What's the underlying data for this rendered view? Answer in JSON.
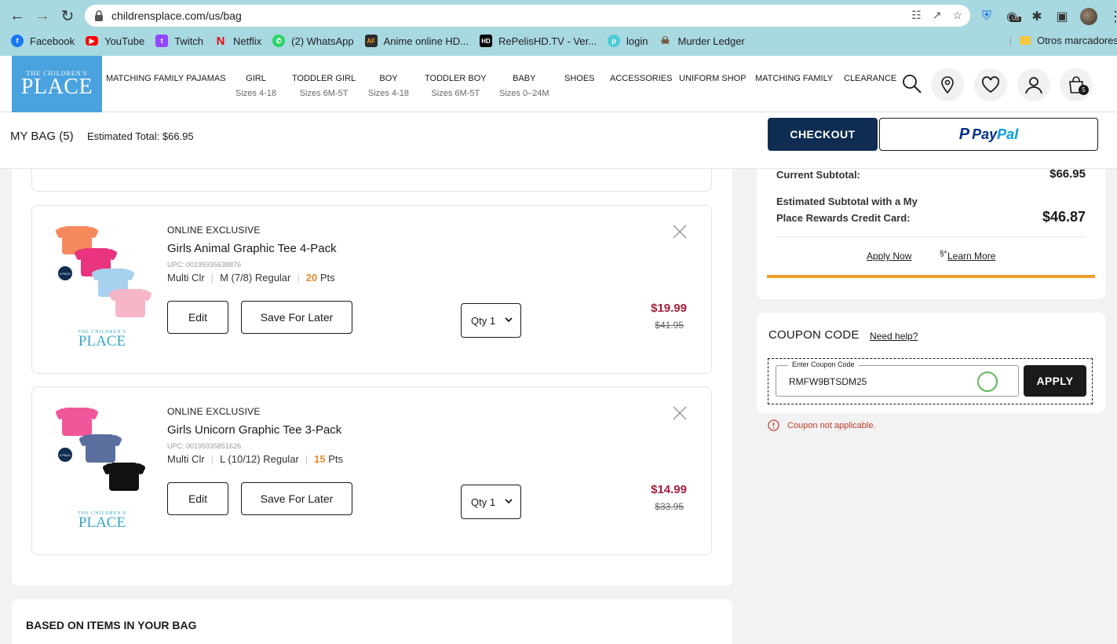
{
  "browser": {
    "url": "childrensplace.com/us/bag",
    "bookmarks": [
      {
        "label": "Facebook",
        "icon": "facebook-icon",
        "color": "#1877f2"
      },
      {
        "label": "YouTube",
        "icon": "youtube-icon",
        "color": "#ff0000"
      },
      {
        "label": "Twitch",
        "icon": "twitch-icon",
        "color": "#9146ff"
      },
      {
        "label": "Netflix",
        "icon": "netflix-icon",
        "color": "#e50914"
      },
      {
        "label": "(2) WhatsApp",
        "icon": "whatsapp-icon",
        "color": "#25d366"
      },
      {
        "label": "Anime online HD...",
        "icon": "animeflv-icon",
        "color": "#2d2d2d"
      },
      {
        "label": "RePelisHD.TV - Ver...",
        "icon": "hd-icon",
        "color": "#000000"
      },
      {
        "label": "login",
        "icon": "tplink-icon",
        "color": "#4acbd6"
      },
      {
        "label": "Murder Ledger",
        "icon": "skull-icon",
        "color": "#6b4a2b"
      }
    ],
    "other_bookmarks": "Otros marcadores",
    "ext_badge": "US"
  },
  "site": {
    "logo_top": "THE CHILDREN'S",
    "logo_main": "PLACE",
    "nav": [
      {
        "label": "MATCHING FAMILY PAJAMAS",
        "sub": ""
      },
      {
        "label": "GIRL",
        "sub": "Sizes 4-18"
      },
      {
        "label": "TODDLER GIRL",
        "sub": "Sizes 6M-5T"
      },
      {
        "label": "BOY",
        "sub": "Sizes 4-18"
      },
      {
        "label": "TODDLER BOY",
        "sub": "Sizes 6M-5T"
      },
      {
        "label": "BABY",
        "sub": "Sizes 0–24M"
      },
      {
        "label": "SHOES",
        "sub": ""
      },
      {
        "label": "ACCESSORIES",
        "sub": ""
      },
      {
        "label": "UNIFORM SHOP",
        "sub": ""
      },
      {
        "label": "MATCHING FAMILY",
        "sub": ""
      },
      {
        "label": "CLEARANCE",
        "sub": ""
      }
    ],
    "bag_count": "5"
  },
  "bag": {
    "title": "MY BAG (5)",
    "estimated_total": "Estimated Total: $66.95",
    "checkout_label": "CHECKOUT",
    "paypal_p": "P",
    "paypal_1": "Pay",
    "paypal_2": "Pal"
  },
  "items": [
    {
      "badge": "ONLINE EXCLUSIVE",
      "name": "Girls Animal Graphic Tee 4-Pack",
      "upc": "UPC: 00195935638876",
      "color": "Multi Clr",
      "size": "M (7/8) Regular",
      "points": "20",
      "points_label": "Pts",
      "edit_label": "Edit",
      "save_label": "Save For Later",
      "qty": "Qty 1",
      "price": "$19.99",
      "was": "$41.95",
      "pack_badge": "4 PACK",
      "mini_logo_top": "THE CHILDREN'S",
      "mini_logo_main": "PLACE"
    },
    {
      "badge": "ONLINE EXCLUSIVE",
      "name": "Girls Unicorn Graphic Tee 3-Pack",
      "upc": "UPC: 00195935851626",
      "color": "Multi Clr",
      "size": "L (10/12) Regular",
      "points": "15",
      "points_label": "Pts",
      "edit_label": "Edit",
      "save_label": "Save For Later",
      "qty": "Qty 1",
      "price": "$14.99",
      "was": "$33.95",
      "pack_badge": "3 PACK",
      "mini_logo_top": "THE CHILDREN'S",
      "mini_logo_main": "PLACE"
    }
  ],
  "summary": {
    "current_subtotal_label": "Current Subtotal:",
    "current_subtotal": "$66.95",
    "rewards_label_1": "Estimated Subtotal with a My",
    "rewards_label_2": "Place Rewards Credit Card:",
    "rewards_subtotal": "$46.87",
    "apply_now": "Apply Now",
    "learn_more_mark": "§*",
    "learn_more": "Learn More"
  },
  "coupon": {
    "title": "COUPON CODE",
    "need_help": "Need help?",
    "field_label": "Enter Coupon Code",
    "field_value": "RMFW9BTSDM25",
    "apply_label": "APPLY",
    "error": "Coupon not applicable."
  },
  "recommendations": {
    "title": "BASED ON ITEMS IN YOUR BAG"
  },
  "colors": {
    "navy": "#0f2d52",
    "logo_blue": "#4aa3df",
    "sale_red": "#a3203c",
    "points_orange": "#e88a2a",
    "accent_orange": "#f09d28",
    "error_red": "#c0392b"
  }
}
